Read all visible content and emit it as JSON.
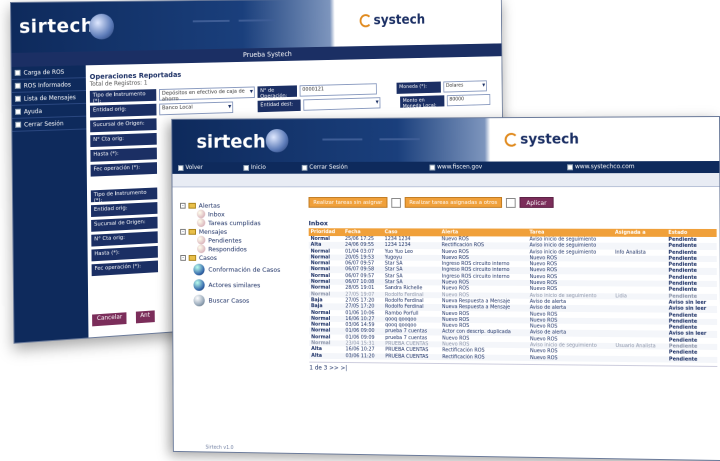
{
  "back": {
    "logo": "sirtech",
    "brand": "systech",
    "bar_title": "Prueba Systech",
    "sidebar": [
      "Carga de ROS",
      "ROS Informados",
      "Lista de Mensajes",
      "Ayuda",
      "Cerrar Sesión"
    ],
    "main_title": "Operaciones Reportadas",
    "main_sub": "Total de Registros: 1",
    "row1": {
      "label": "Tipo de Instrumento (*):",
      "value": "Depósitos en efectivo de caja de ahorro",
      "label2": "N° de Operación:",
      "value2": "0000121",
      "label3": "Moneda (*):",
      "value3": "Dolares"
    },
    "row2": {
      "label": "Entidad orig:",
      "value": "Banco Local",
      "label2": "Entidad dest:",
      "value2": "",
      "label3": "Monto en Moneda Local:",
      "value3": "80000"
    },
    "row3": {
      "label": "Sucursal de Origen:"
    },
    "row4": {
      "label": "N° Cta orig:"
    },
    "row5": {
      "label": "Hasta (*):"
    },
    "row6": {
      "label": "Fec operación (*):"
    },
    "row7": {
      "label": "Tipo de Instrumento (*):"
    },
    "row8": {
      "label": "Entidad orig:"
    },
    "row9": {
      "label": "Sucursal de Origen:"
    },
    "row10": {
      "label": "N° Cta orig:"
    },
    "row11": {
      "label": "Hasta (*):"
    },
    "row12": {
      "label": "Fec operación (*):"
    },
    "btn_cancel": "Cancelar",
    "btn_other": "Ant"
  },
  "front": {
    "logo": "sirtech",
    "brand": "systech",
    "nav": [
      "Volver",
      "Inicio",
      "Cerrar Sesión",
      "www.fiscen.gov",
      "www.systechco.com"
    ],
    "tree": {
      "alertas": "Alertas",
      "inbox": "Inbox",
      "tareas": "Tareas cumplidas",
      "mensajes": "Mensajes",
      "pendientes": "Pendientes",
      "respondidos": "Respondidos",
      "casos": "Casos",
      "conformacion": "Conformación de Casos",
      "actores": "Actores similares",
      "buscar": "Buscar Casos"
    },
    "toolbar": {
      "b1": "Realizar tareas sin asignar",
      "b2": "Realizar tareas asignadas a otros",
      "apply": "Aplicar"
    },
    "inbox_title": "Inbox",
    "columns": [
      "Prioridad",
      "Fecha",
      "Caso",
      "Alerta",
      "Tarea",
      "Asignada a",
      "Estado"
    ],
    "rows": [
      [
        "Normal",
        "25/06 17:25",
        "1234 1234",
        "Nuevo ROS",
        "Aviso inicio de seguimiento",
        "",
        "Pendiente"
      ],
      [
        "Alta",
        "24/06 09:55",
        "1234 1234",
        "Rectificación ROS",
        "Aviso inicio de seguimiento",
        "",
        "Pendiente"
      ],
      [
        "Normal",
        "01/04 03:07",
        "Yuo Yuo Leo",
        "Nuevo ROS",
        "Aviso inicio de seguimiento",
        "Info Analista",
        "Pendiente"
      ],
      [
        "Normal",
        "20/05 19:53",
        "Yugoyu",
        "Nuevo ROS",
        "Nuevo ROS",
        "",
        "Pendiente"
      ],
      [
        "Normal",
        "06/07 09:57",
        "Star SA",
        "Ingreso ROS circuito interno",
        "Nuevo ROS",
        "",
        "Pendiente"
      ],
      [
        "Normal",
        "06/07 09:58",
        "Star SA",
        "Ingreso ROS circuito interno",
        "Nuevo ROS",
        "",
        "Pendiente"
      ],
      [
        "Normal",
        "06/07 09:57",
        "Star SA",
        "Ingreso ROS circuito interno",
        "Nuevo ROS",
        "",
        "Pendiente"
      ],
      [
        "Normal",
        "06/07 10:08",
        "Star SA",
        "Nuevo ROS",
        "Nuevo ROS",
        "",
        "Pendiente"
      ],
      [
        "Normal",
        "28/05 19:01",
        "Sandra Richelle",
        "Nuevo ROS",
        "Nuevo ROS",
        "",
        "Pendiente"
      ],
      [
        "Normal",
        "27/05 19:07",
        "Rodolfo Ferdinal",
        "Nuevo ROS",
        "Aviso inicio de seguimiento",
        "Lidia",
        "Pendiente"
      ],
      [
        "Baja",
        "27/05 17:20",
        "Rodolfo Ferdinal",
        "Nueva Respuesta a Mensaje",
        "Aviso de alerta",
        "",
        "Aviso sin leer"
      ],
      [
        "Baja",
        "27/05 17:20",
        "Rodolfo Ferdinal",
        "Nueva Respuesta a Mensaje",
        "Aviso de alerta",
        "",
        "Aviso sin leer"
      ],
      [
        "Normal",
        "01/06 10:06",
        "Rambo Porfull",
        "Nuevo ROS",
        "Nuevo ROS",
        "",
        "Pendiente"
      ],
      [
        "Normal",
        "16/06 10:27",
        "qooq qooqoo",
        "Nuevo ROS",
        "Nuevo ROS",
        "",
        "Pendiente"
      ],
      [
        "Normal",
        "03/06 14:59",
        "qooq qooqoo",
        "Nuevo ROS",
        "Nuevo ROS",
        "",
        "Pendiente"
      ],
      [
        "Normal",
        "01/06 09:00",
        "prueba 7 cuentas",
        "Actor con descrip. duplicada",
        "Aviso de alerta",
        "",
        "Aviso sin leer"
      ],
      [
        "Normal",
        "01/06 09:09",
        "prueba 7 cuentas",
        "Nuevo ROS",
        "Nuevo ROS",
        "",
        "Pendiente"
      ],
      [
        "Normal",
        "23/04 15:31",
        "PRUEBA CUENTAS",
        "Nuevo ROS",
        "Aviso inicio de seguimiento",
        "Usuario Analista",
        "Pendiente"
      ],
      [
        "Alta",
        "16/06 10:27",
        "PRUEBA CUENTAS",
        "Rectificación ROS",
        "Nuevo ROS",
        "",
        "Pendiente"
      ],
      [
        "Alta",
        "03/06 11:20",
        "PRUEBA CUENTAS",
        "Rectificación ROS",
        "Nuevo ROS",
        "",
        "Pendiente"
      ]
    ],
    "pager": "1 de 3 >> >|",
    "version": "Sirtech v1.0"
  }
}
